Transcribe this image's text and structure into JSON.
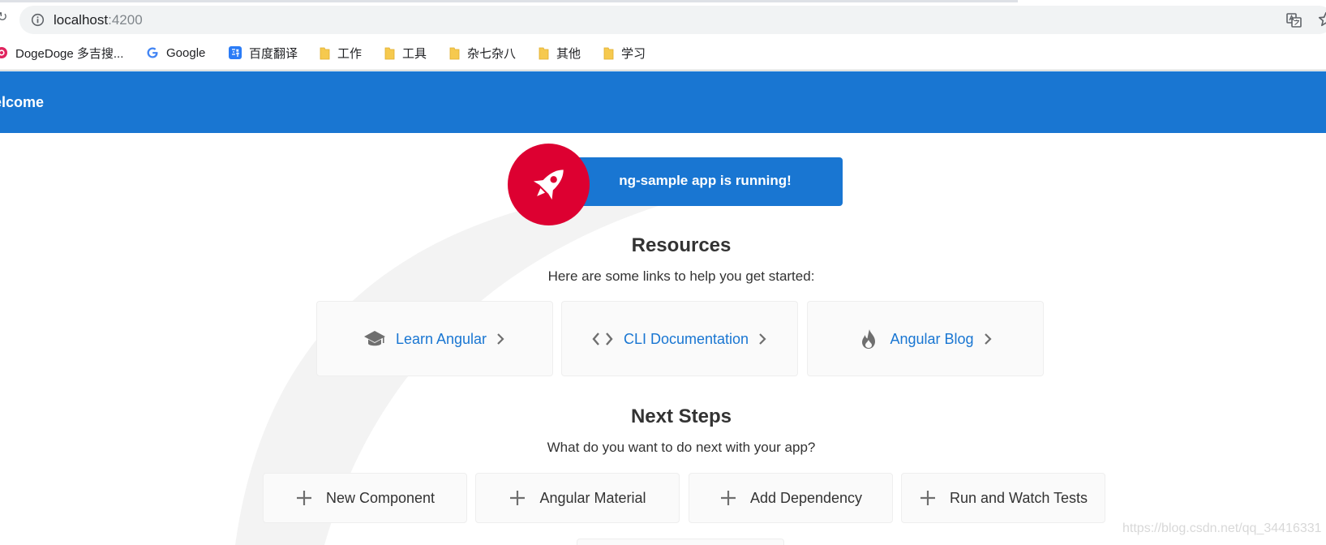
{
  "browser": {
    "url_host": "localhost",
    "url_port": ":4200",
    "bookmarks": [
      {
        "label": "DogeDoge 多吉搜...",
        "icon": "dogedoge-icon"
      },
      {
        "label": "Google",
        "icon": "google-icon"
      },
      {
        "label": "百度翻译",
        "icon": "baidu-translate-icon"
      },
      {
        "label": "工作",
        "icon": "folder-icon"
      },
      {
        "label": "工具",
        "icon": "folder-icon"
      },
      {
        "label": "杂七杂八",
        "icon": "folder-icon"
      },
      {
        "label": "其他",
        "icon": "folder-icon"
      },
      {
        "label": "学习",
        "icon": "folder-icon"
      }
    ]
  },
  "toolbar": {
    "title": "elcome"
  },
  "hero": {
    "running_text": "ng-sample app is running!"
  },
  "resources": {
    "title": "Resources",
    "subtitle": "Here are some links to help you get started:",
    "cards": [
      {
        "label": "Learn Angular",
        "icon": "graduation-cap-icon"
      },
      {
        "label": "CLI Documentation",
        "icon": "code-brackets-icon"
      },
      {
        "label": "Angular Blog",
        "icon": "flame-icon"
      }
    ]
  },
  "next_steps": {
    "title": "Next Steps",
    "subtitle": "What do you want to do next with your app?",
    "cards": [
      {
        "label": "New Component",
        "icon": "plus-icon"
      },
      {
        "label": "Angular Material",
        "icon": "plus-icon"
      },
      {
        "label": "Add Dependency",
        "icon": "plus-icon"
      },
      {
        "label": "Run and Watch Tests",
        "icon": "plus-icon"
      }
    ]
  },
  "watermark": "https://blog.csdn.net/qq_34416331",
  "colors": {
    "toolbar": "#1976d2",
    "rocket_badge": "#dd0031",
    "link": "#1976d2",
    "folder": "#f6c94e"
  }
}
